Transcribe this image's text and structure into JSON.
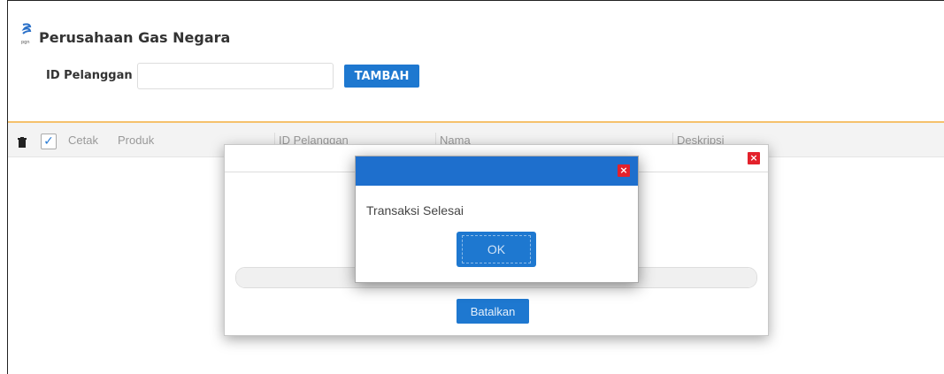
{
  "header": {
    "company_name": "Perusahaan Gas Negara",
    "logo_icon": "pgn-logo-icon",
    "logo_caption": "pgn"
  },
  "form": {
    "id_label": "ID Pelanggan",
    "id_value": "",
    "add_button": "TAMBAH"
  },
  "grid": {
    "delete_icon": "trash-icon",
    "checkbox_checked": true,
    "columns": [
      "Cetak",
      "Produk",
      "ID Pelanggan",
      "Nama",
      "Deskripsi"
    ]
  },
  "dialog": {
    "close_label": "×",
    "progress_text": "OK",
    "cancel_button": "Batalkan"
  },
  "alert": {
    "close_label": "×",
    "message": "Transaksi Selesai",
    "ok_button": "OK"
  },
  "colors": {
    "accent": "#1e78d0",
    "alert_header": "#1e6fcd",
    "close_red": "#e3212b",
    "grid_top_border": "#f5c16c"
  }
}
